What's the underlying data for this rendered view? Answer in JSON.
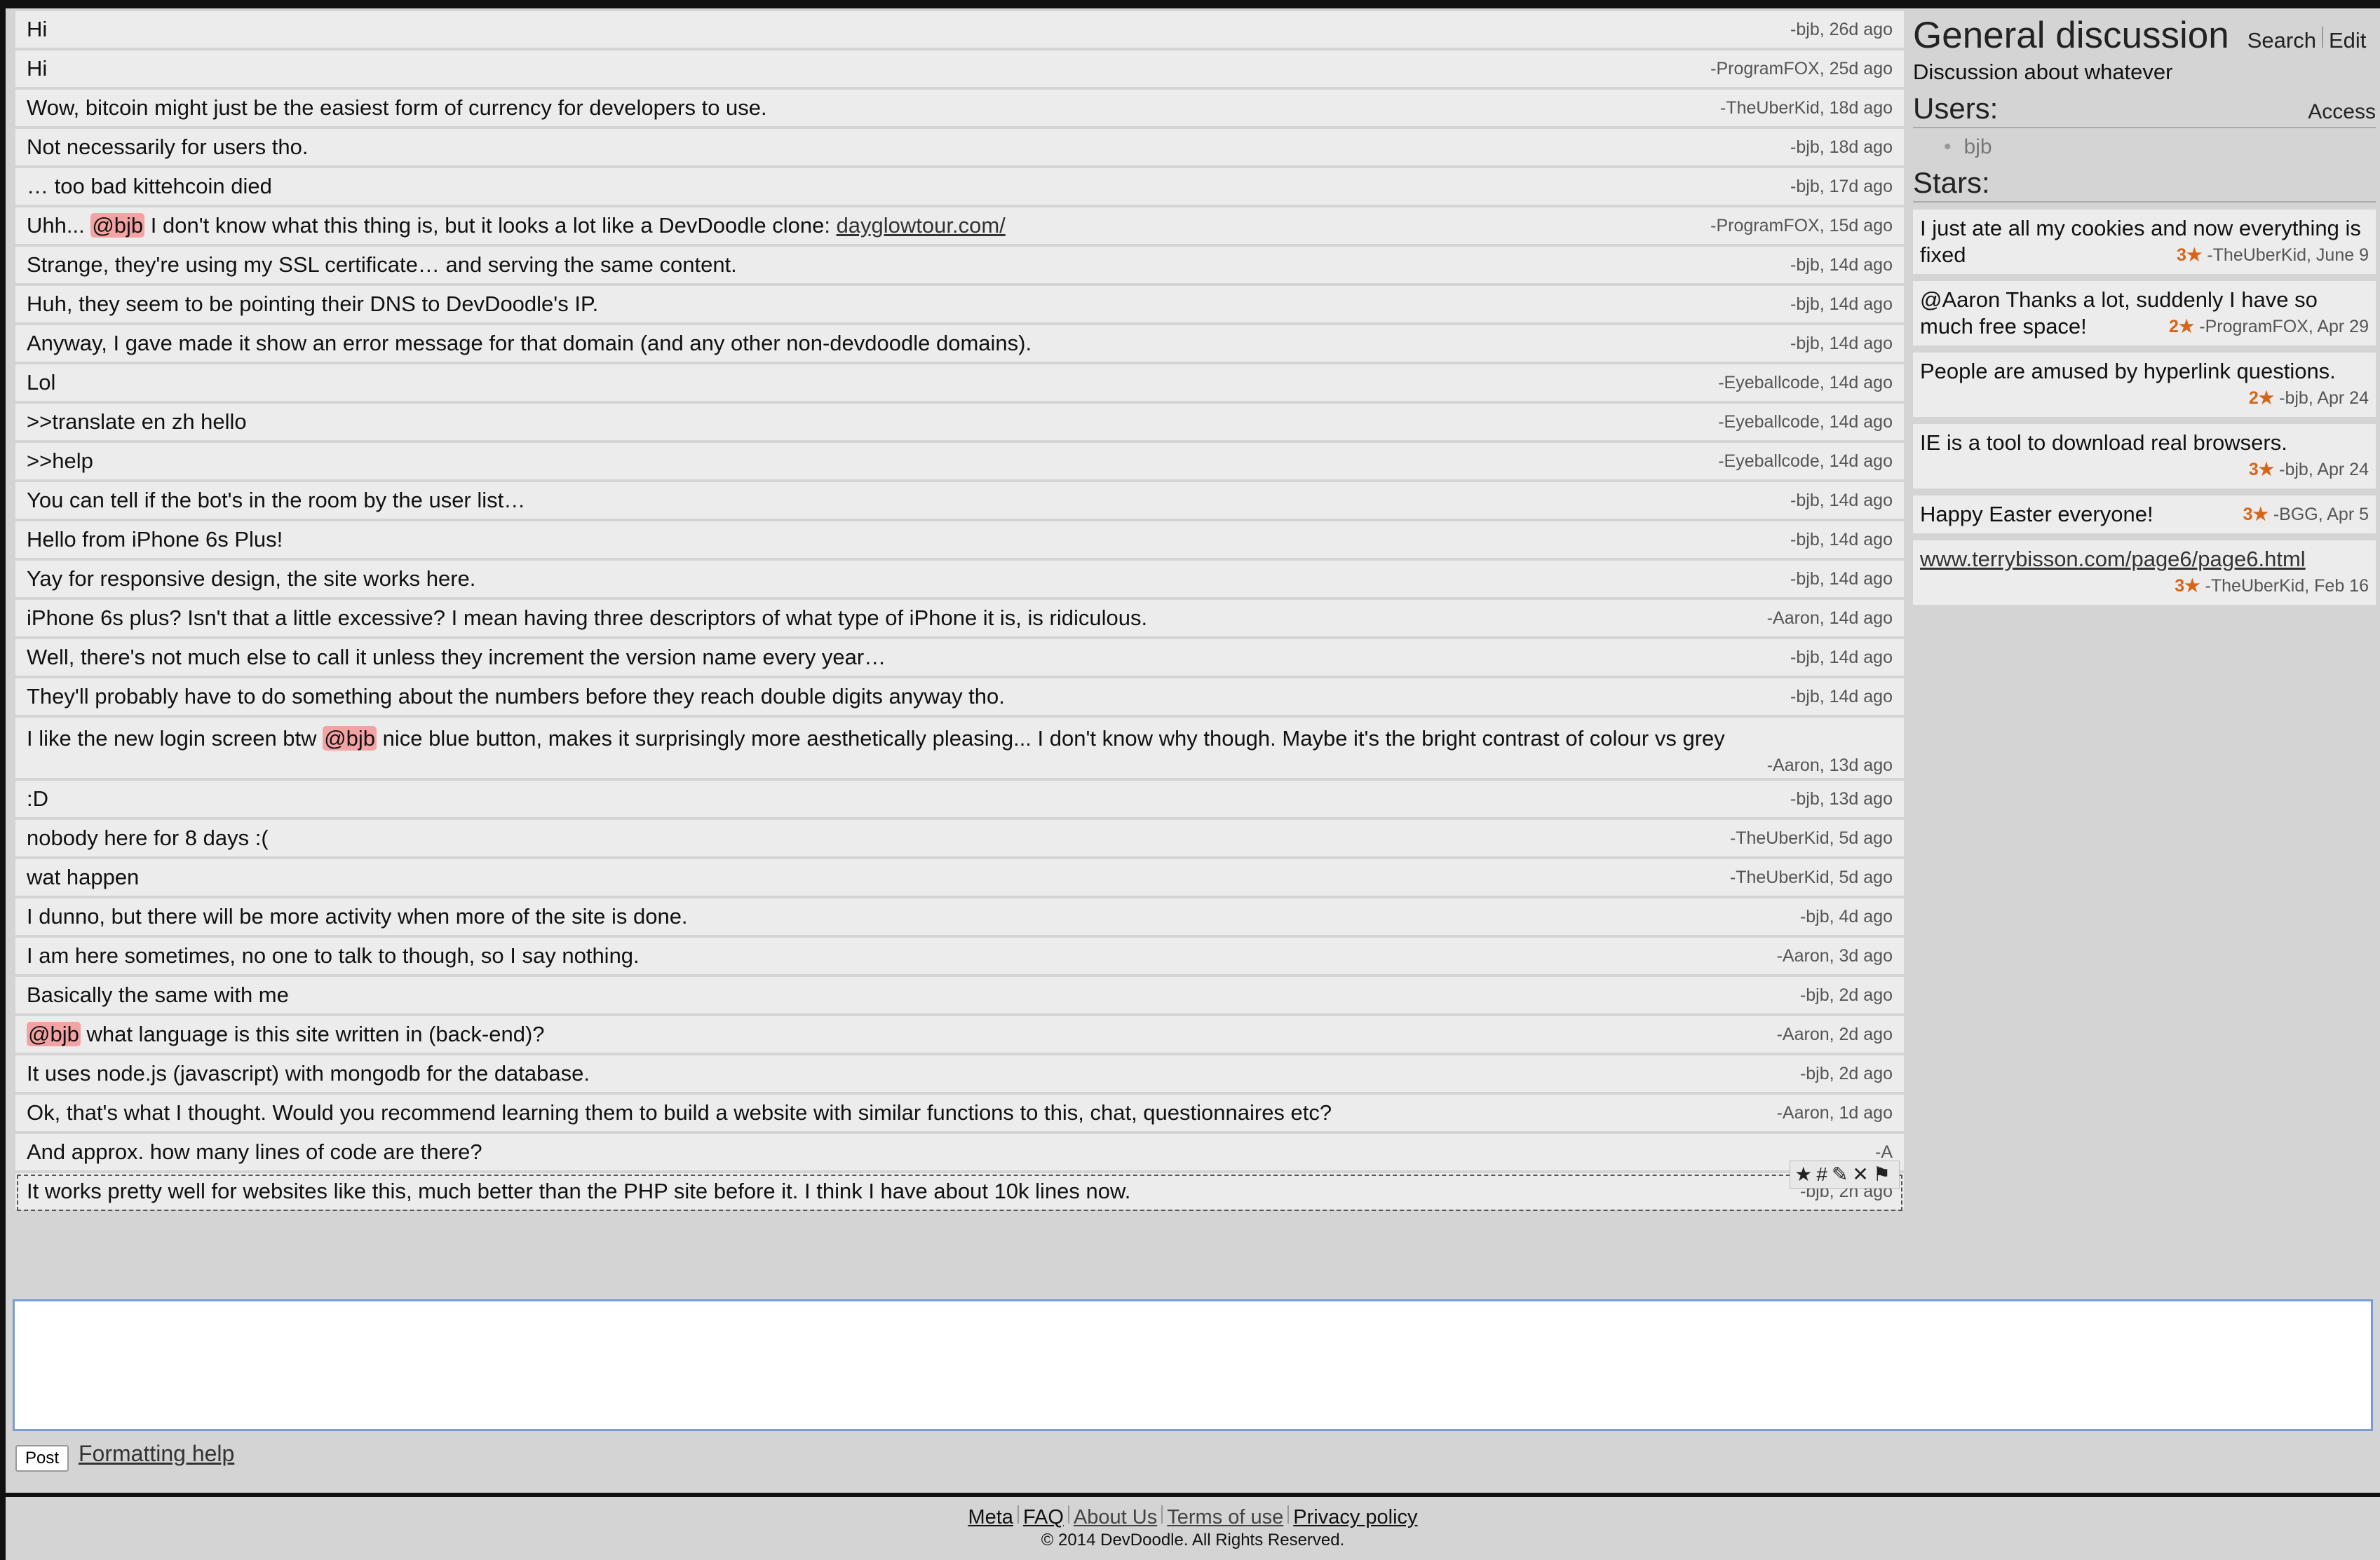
{
  "room": {
    "title": "General discussion",
    "search_label": "Search",
    "edit_label": "Edit",
    "description": "Discussion about whatever",
    "users_heading": "Users:",
    "access_label": "Access",
    "users": [
      "bjb"
    ],
    "stars_heading": "Stars:"
  },
  "messages": [
    {
      "text": "Hi",
      "meta": "-bjb, 26d ago"
    },
    {
      "text": "Hi",
      "meta": "-ProgramFOX, 25d ago"
    },
    {
      "text": "Wow, bitcoin might just be the easiest form of currency for developers to use.",
      "meta": "-TheUberKid, 18d ago"
    },
    {
      "text": "Not necessarily for users tho.",
      "meta": "-bjb, 18d ago"
    },
    {
      "text": "… too bad kittehcoin died",
      "meta": "-bjb, 17d ago"
    },
    {
      "pre": "Uhh... ",
      "mention": "@bjb",
      "post": " I don't know what this thing is, but it looks a lot like a DevDoodle clone: ",
      "link": "dayglowtour.com/",
      "meta": "-ProgramFOX, 15d ago"
    },
    {
      "text": "Strange, they're using my SSL certificate… and serving the same content.",
      "meta": "-bjb, 14d ago"
    },
    {
      "text": "Huh, they seem to be pointing their DNS to DevDoodle's IP.",
      "meta": "-bjb, 14d ago"
    },
    {
      "text": "Anyway, I gave made it show an error message for that domain (and any other non-devdoodle domains).",
      "meta": "-bjb, 14d ago"
    },
    {
      "text": "Lol",
      "meta": "-Eyeballcode, 14d ago"
    },
    {
      "text": ">>translate en zh hello",
      "meta": "-Eyeballcode, 14d ago"
    },
    {
      "text": ">>help",
      "meta": "-Eyeballcode, 14d ago"
    },
    {
      "text": "You can tell if the bot's in the room by the user list…",
      "meta": "-bjb, 14d ago"
    },
    {
      "text": "Hello from iPhone 6s Plus!",
      "meta": "-bjb, 14d ago"
    },
    {
      "text": "Yay for responsive design, the site works here.",
      "meta": "-bjb, 14d ago"
    },
    {
      "text": "iPhone 6s plus? Isn't that a little excessive? I mean having three descriptors of what type of iPhone it is, is ridiculous.",
      "meta": "-Aaron, 14d ago"
    },
    {
      "text": "Well, there's not much else to call it unless they increment the version name every year…",
      "meta": "-bjb, 14d ago"
    },
    {
      "text": "They'll probably have to do something about the numbers before they reach double digits anyway tho.",
      "meta": "-bjb, 14d ago"
    },
    {
      "pre": "I like the new login screen btw ",
      "mention": "@bjb",
      "post": " nice blue button, makes it surprisingly more aesthetically pleasing... I don't know why though. Maybe it's the bright contrast of colour vs grey",
      "meta": "-Aaron, 13d ago"
    },
    {
      "text": ":D",
      "meta": "-bjb, 13d ago"
    },
    {
      "text": "nobody here for 8 days :(",
      "meta": "-TheUberKid, 5d ago"
    },
    {
      "text": "wat happen",
      "meta": "-TheUberKid, 5d ago"
    },
    {
      "text": "I dunno, but there will be more activity when more of the site is done.",
      "meta": "-bjb, 4d ago"
    },
    {
      "text": "I am here sometimes, no one to talk to though, so I say nothing.",
      "meta": "-Aaron, 3d ago"
    },
    {
      "text": "Basically the same with me",
      "meta": "-bjb, 2d ago"
    },
    {
      "pre": "",
      "mention": "@bjb",
      "post": " what language is this site written in (back-end)?",
      "meta": "-Aaron, 2d ago"
    },
    {
      "text": "It uses node.js (javascript) with mongodb for the database.",
      "meta": "-bjb, 2d ago"
    },
    {
      "text": "Ok, that's what I thought. Would you recommend learning them to build a website with similar functions to this, chat, questionnaires etc?",
      "meta": "-Aaron, 1d ago"
    },
    {
      "text": "And approx. how many lines of code are there?",
      "meta": "-A"
    },
    {
      "text": "It works pretty well for websites like this, much better than the PHP site before it. I think I have about 10k lines now.",
      "meta": "-bjb, 2h ago"
    }
  ],
  "message_tools": "★#✎✕⚑",
  "stars": [
    {
      "text": "I just ate all my cookies and now everything is fixed",
      "count": "3★",
      "meta": " -TheUberKid, June 9"
    },
    {
      "text": "@Aaron Thanks a lot, suddenly I have so much free space!",
      "count": "2★",
      "meta": " -ProgramFOX, Apr 29"
    },
    {
      "text": "People are amused by hyperlink questions.",
      "count": "2★",
      "meta": " -bjb, Apr 24"
    },
    {
      "text": "IE is a tool to download real browsers.",
      "count": "3★",
      "meta": " -bjb, Apr 24"
    },
    {
      "text": "Happy Easter everyone!",
      "count": "3★",
      "meta": " -BGG, Apr 5"
    },
    {
      "text": "www.terrybisson.com/page6/page6.html",
      "link": true,
      "count": "3★",
      "meta": " -TheUberKid, Feb 16"
    }
  ],
  "composer": {
    "post_label": "Post",
    "help_label": "Formatting help",
    "value": ""
  },
  "footer": {
    "links": [
      "Meta",
      "FAQ",
      "About Us",
      "Terms of use",
      "Privacy policy"
    ],
    "copyright": "© 2014 DevDoodle. All Rights Reserved."
  },
  "colors": {
    "mention_bg": "#f3a3a3",
    "star_count": "#d8641a",
    "input_border": "#7a9cd0"
  }
}
